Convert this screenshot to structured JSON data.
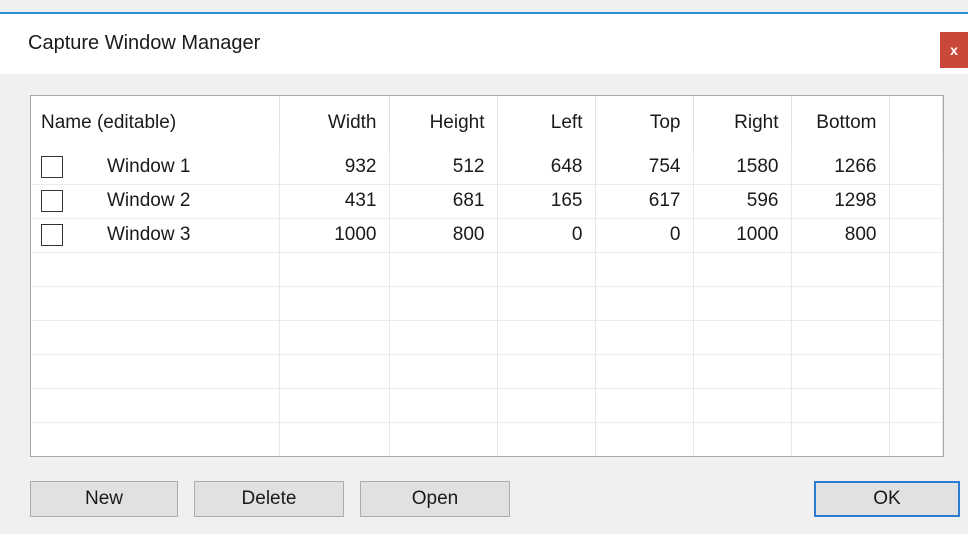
{
  "window": {
    "title": "Capture Window Manager",
    "close_label": "x"
  },
  "table": {
    "headers": [
      "Name (editable)",
      "Width",
      "Height",
      "Left",
      "Top",
      "Right",
      "Bottom"
    ],
    "rows": [
      {
        "name": "Window 1",
        "width": "932",
        "height": "512",
        "left": "648",
        "top": "754",
        "right": "1580",
        "bottom": "1266"
      },
      {
        "name": "Window 2",
        "width": "431",
        "height": "681",
        "left": "165",
        "top": "617",
        "right": "596",
        "bottom": "1298"
      },
      {
        "name": "Window 3",
        "width": "1000",
        "height": "800",
        "left": "0",
        "top": "0",
        "right": "1000",
        "bottom": "800"
      }
    ]
  },
  "buttons": {
    "new": "New",
    "delete": "Delete",
    "open": "Open",
    "ok": "OK"
  },
  "colors": {
    "accent": "#2b8fd6",
    "close": "#c9483a"
  }
}
